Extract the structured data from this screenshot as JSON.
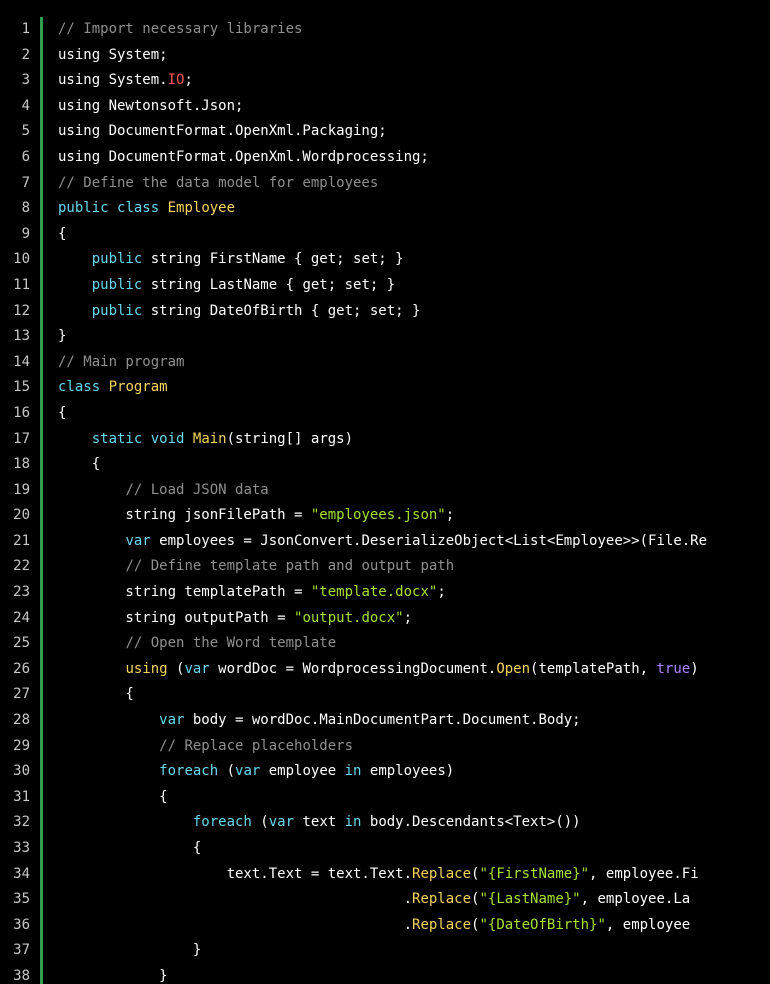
{
  "colors": {
    "background": "#000000",
    "text": "#ffffff",
    "line_numbers": "#c8c8c8",
    "gutter_accent": "#2e9e4e",
    "keyword": "#66d9ef",
    "comment": "#8f8f8f",
    "string": "#a6e22e",
    "type_or_method": "#f3d55b",
    "error_token": "#ff5555",
    "boolean": "#ae81ff"
  },
  "lines": [
    [
      {
        "t": "cm",
        "v": "// Import necessary libraries"
      }
    ],
    [
      {
        "t": "pl",
        "v": "using System;"
      }
    ],
    [
      {
        "t": "pl",
        "v": "using System."
      },
      {
        "t": "io",
        "v": "IO"
      },
      {
        "t": "pl",
        "v": ";"
      }
    ],
    [
      {
        "t": "pl",
        "v": "using Newtonsoft.Json;"
      }
    ],
    [
      {
        "t": "pl",
        "v": "using DocumentFormat.OpenXml.Packaging;"
      }
    ],
    [
      {
        "t": "pl",
        "v": "using DocumentFormat.OpenXml.Wordprocessing;"
      }
    ],
    [
      {
        "t": "cm",
        "v": "// Define the data model for employees"
      }
    ],
    [
      {
        "t": "kw",
        "v": "public"
      },
      {
        "t": "pl",
        "v": " "
      },
      {
        "t": "kw",
        "v": "class"
      },
      {
        "t": "pl",
        "v": " "
      },
      {
        "t": "ty",
        "v": "Employee"
      }
    ],
    [
      {
        "t": "pl",
        "v": "{"
      }
    ],
    [
      {
        "t": "pl",
        "v": "    "
      },
      {
        "t": "kw",
        "v": "public"
      },
      {
        "t": "pl",
        "v": " string FirstName { get; set; }"
      }
    ],
    [
      {
        "t": "pl",
        "v": "    "
      },
      {
        "t": "kw",
        "v": "public"
      },
      {
        "t": "pl",
        "v": " string LastName { get; set; }"
      }
    ],
    [
      {
        "t": "pl",
        "v": "    "
      },
      {
        "t": "kw",
        "v": "public"
      },
      {
        "t": "pl",
        "v": " string DateOfBirth { get; set; }"
      }
    ],
    [
      {
        "t": "pl",
        "v": "}"
      }
    ],
    [
      {
        "t": "cm",
        "v": "// Main program"
      }
    ],
    [
      {
        "t": "kw",
        "v": "class"
      },
      {
        "t": "pl",
        "v": " "
      },
      {
        "t": "ty",
        "v": "Program"
      }
    ],
    [
      {
        "t": "pl",
        "v": "{"
      }
    ],
    [
      {
        "t": "pl",
        "v": "    "
      },
      {
        "t": "kw",
        "v": "static"
      },
      {
        "t": "pl",
        "v": " "
      },
      {
        "t": "kw",
        "v": "void"
      },
      {
        "t": "pl",
        "v": " "
      },
      {
        "t": "fn",
        "v": "Main"
      },
      {
        "t": "pl",
        "v": "(string[] args)"
      }
    ],
    [
      {
        "t": "pl",
        "v": "    {"
      }
    ],
    [
      {
        "t": "pl",
        "v": "        "
      },
      {
        "t": "cm",
        "v": "// Load JSON data"
      }
    ],
    [
      {
        "t": "pl",
        "v": "        string jsonFilePath = "
      },
      {
        "t": "st",
        "v": "\"employees.json\""
      },
      {
        "t": "pl",
        "v": ";"
      }
    ],
    [
      {
        "t": "pl",
        "v": "        "
      },
      {
        "t": "kw",
        "v": "var"
      },
      {
        "t": "pl",
        "v": " employees = JsonConvert.DeserializeObject<List<Employee>>(File.Re"
      }
    ],
    [
      {
        "t": "pl",
        "v": "        "
      },
      {
        "t": "cm",
        "v": "// Define template path and output path"
      }
    ],
    [
      {
        "t": "pl",
        "v": "        string templatePath = "
      },
      {
        "t": "st",
        "v": "\"template.docx\""
      },
      {
        "t": "pl",
        "v": ";"
      }
    ],
    [
      {
        "t": "pl",
        "v": "        string outputPath = "
      },
      {
        "t": "st",
        "v": "\"output.docx\""
      },
      {
        "t": "pl",
        "v": ";"
      }
    ],
    [
      {
        "t": "pl",
        "v": "        "
      },
      {
        "t": "cm",
        "v": "// Open the Word template"
      }
    ],
    [
      {
        "t": "pl",
        "v": "        "
      },
      {
        "t": "mt",
        "v": "using"
      },
      {
        "t": "pl",
        "v": " ("
      },
      {
        "t": "kw",
        "v": "var"
      },
      {
        "t": "pl",
        "v": " wordDoc = WordprocessingDocument."
      },
      {
        "t": "mt",
        "v": "Open"
      },
      {
        "t": "pl",
        "v": "(templatePath, "
      },
      {
        "t": "bl",
        "v": "true"
      },
      {
        "t": "pl",
        "v": ")"
      }
    ],
    [
      {
        "t": "pl",
        "v": "        {"
      }
    ],
    [
      {
        "t": "pl",
        "v": "            "
      },
      {
        "t": "kw",
        "v": "var"
      },
      {
        "t": "pl",
        "v": " body = wordDoc.MainDocumentPart.Document.Body;"
      }
    ],
    [
      {
        "t": "pl",
        "v": "            "
      },
      {
        "t": "cm",
        "v": "// Replace placeholders"
      }
    ],
    [
      {
        "t": "pl",
        "v": "            "
      },
      {
        "t": "kw",
        "v": "foreach"
      },
      {
        "t": "pl",
        "v": " ("
      },
      {
        "t": "kw",
        "v": "var"
      },
      {
        "t": "pl",
        "v": " employee "
      },
      {
        "t": "kw",
        "v": "in"
      },
      {
        "t": "pl",
        "v": " employees)"
      }
    ],
    [
      {
        "t": "pl",
        "v": "            {"
      }
    ],
    [
      {
        "t": "pl",
        "v": "                "
      },
      {
        "t": "kw",
        "v": "foreach"
      },
      {
        "t": "pl",
        "v": " ("
      },
      {
        "t": "kw",
        "v": "var"
      },
      {
        "t": "pl",
        "v": " text "
      },
      {
        "t": "kw",
        "v": "in"
      },
      {
        "t": "pl",
        "v": " body.Descendants<Text>())"
      }
    ],
    [
      {
        "t": "pl",
        "v": "                {"
      }
    ],
    [
      {
        "t": "pl",
        "v": "                    text.Text = text.Text."
      },
      {
        "t": "mt",
        "v": "Replace"
      },
      {
        "t": "pl",
        "v": "("
      },
      {
        "t": "st",
        "v": "\"{FirstName}\""
      },
      {
        "t": "pl",
        "v": ", employee.Fi"
      }
    ],
    [
      {
        "t": "pl",
        "v": "                                         ."
      },
      {
        "t": "mt",
        "v": "Replace"
      },
      {
        "t": "pl",
        "v": "("
      },
      {
        "t": "st",
        "v": "\"{LastName}\""
      },
      {
        "t": "pl",
        "v": ", employee.La"
      }
    ],
    [
      {
        "t": "pl",
        "v": "                                         ."
      },
      {
        "t": "mt",
        "v": "Replace"
      },
      {
        "t": "pl",
        "v": "("
      },
      {
        "t": "st",
        "v": "\"{DateOfBirth}\""
      },
      {
        "t": "pl",
        "v": ", employee"
      }
    ],
    [
      {
        "t": "pl",
        "v": "                }"
      }
    ],
    [
      {
        "t": "pl",
        "v": "            }"
      }
    ]
  ],
  "line_numbers": [
    "1",
    "2",
    "3",
    "4",
    "5",
    "6",
    "7",
    "8",
    "9",
    "10",
    "11",
    "12",
    "13",
    "14",
    "15",
    "16",
    "17",
    "18",
    "19",
    "20",
    "21",
    "22",
    "23",
    "24",
    "25",
    "26",
    "27",
    "28",
    "29",
    "30",
    "31",
    "32",
    "33",
    "34",
    "35",
    "36",
    "37",
    "38"
  ]
}
